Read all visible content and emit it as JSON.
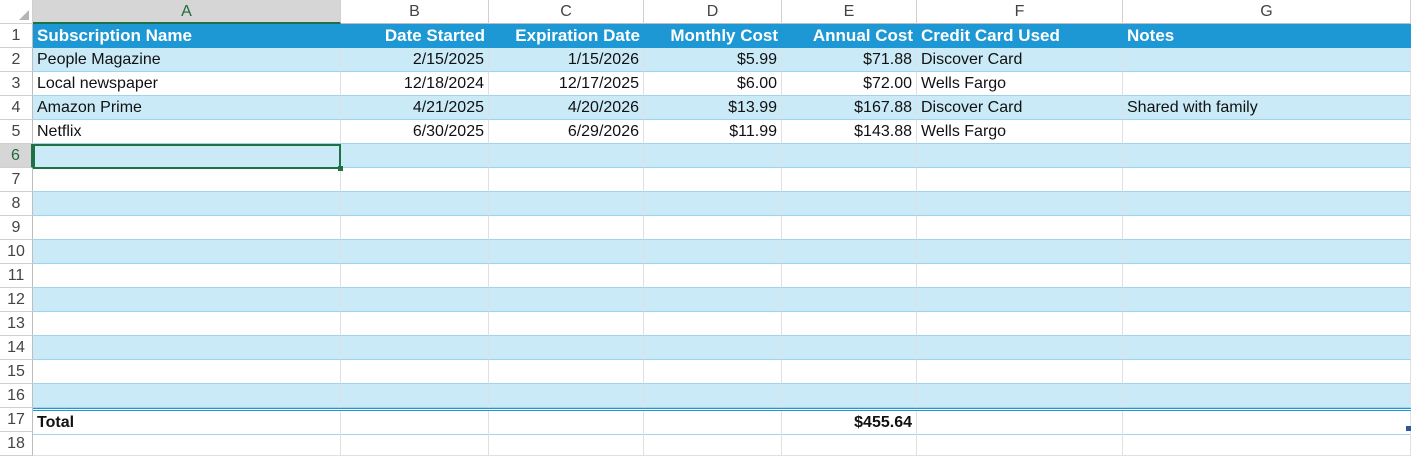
{
  "columns": [
    "A",
    "B",
    "C",
    "D",
    "E",
    "F",
    "G"
  ],
  "active_column": "A",
  "row_numbers": [
    "1",
    "2",
    "3",
    "4",
    "5",
    "6",
    "7",
    "8",
    "9",
    "10",
    "11",
    "12",
    "13",
    "14",
    "15",
    "16",
    "17",
    "18"
  ],
  "active_row": "6",
  "header_row": {
    "name": "Subscription Name",
    "started": "Date Started",
    "expiration": "Expiration Date",
    "monthly": "Monthly Cost",
    "annual": "Annual Cost",
    "card": "Credit Card Used",
    "notes": "Notes"
  },
  "data_rows": [
    {
      "name": "People Magazine",
      "started": "2/15/2025",
      "expiration": "1/15/2026",
      "monthly": "$5.99",
      "annual": "$71.88",
      "card": "Discover Card",
      "notes": ""
    },
    {
      "name": "Local newspaper",
      "started": "12/18/2024",
      "expiration": "12/17/2025",
      "monthly": "$6.00",
      "annual": "$72.00",
      "card": "Wells Fargo",
      "notes": ""
    },
    {
      "name": "Amazon Prime",
      "started": "4/21/2025",
      "expiration": "4/20/2026",
      "monthly": "$13.99",
      "annual": "$167.88",
      "card": "Discover Card",
      "notes": "Shared with family"
    },
    {
      "name": "Netflix",
      "started": "6/30/2025",
      "expiration": "6/29/2026",
      "monthly": "$11.99",
      "annual": "$143.88",
      "card": "Wells Fargo",
      "notes": ""
    }
  ],
  "total_row": {
    "label": "Total",
    "annual": "$455.64"
  },
  "selected_cell": "A6",
  "colors": {
    "header_fill": "#1e98d4",
    "band_fill": "#caeaf8",
    "selection_border": "#1e7145"
  }
}
